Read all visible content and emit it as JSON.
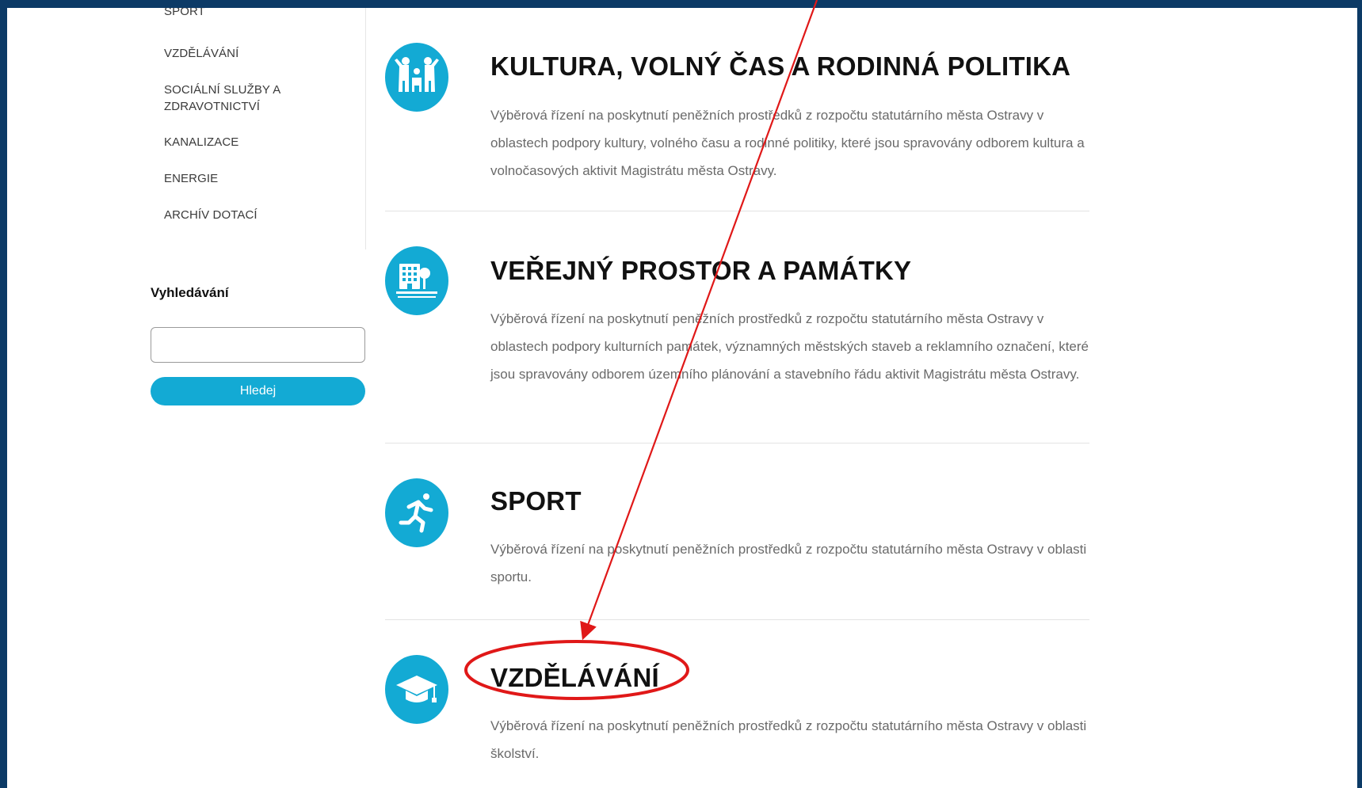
{
  "sidebar": {
    "items": [
      {
        "label": "SPORT"
      },
      {
        "label": "VZDĚLÁVÁNÍ"
      },
      {
        "label": "SOCIÁLNÍ SLUŽBY A ZDRAVOTNICTVÍ"
      },
      {
        "label": "KANALIZACE"
      },
      {
        "label": "ENERGIE"
      },
      {
        "label": "ARCHÍV DOTACÍ"
      }
    ]
  },
  "search": {
    "title": "Vyhledávání",
    "value": "",
    "button_label": "Hledej"
  },
  "cards": [
    {
      "title": "KULTURA, VOLNÝ ČAS A RODINNÁ POLITIKA",
      "description": "Výběrová řízení na poskytnutí peněžních prostředků z rozpočtu statutárního města Ostravy v oblastech podpory kultury, volného času a rodinné politiky, které jsou spravovány odborem kultura a volnočasových aktivit Magistrátu města Ostravy.",
      "icon": "family-icon"
    },
    {
      "title": "VEŘEJNÝ PROSTOR A PAMÁTKY",
      "description": "Výběrová řízení na poskytnutí peněžních prostředků z rozpočtu statutárního města Ostravy v oblastech podpory kulturních památek, významných městských staveb a reklamního označení, které jsou spravovány odborem územního plánování a stavebního řádu aktivit Magistrátu města Ostravy.",
      "icon": "building-icon"
    },
    {
      "title": "SPORT",
      "description": "Výběrová řízení na poskytnutí peněžních prostředků z rozpočtu statutárního města Ostravy v oblasti sportu.",
      "icon": "runner-icon"
    },
    {
      "title": "VZDĚLÁVÁNÍ",
      "description": "Výběrová řízení na poskytnutí peněžních prostředků z rozpočtu statutárního města Ostravy v oblasti školství.",
      "icon": "graduation-cap-icon"
    }
  ],
  "colors": {
    "accent": "#13aad4",
    "frame": "#0c3a66",
    "annotation": "#e01818"
  }
}
